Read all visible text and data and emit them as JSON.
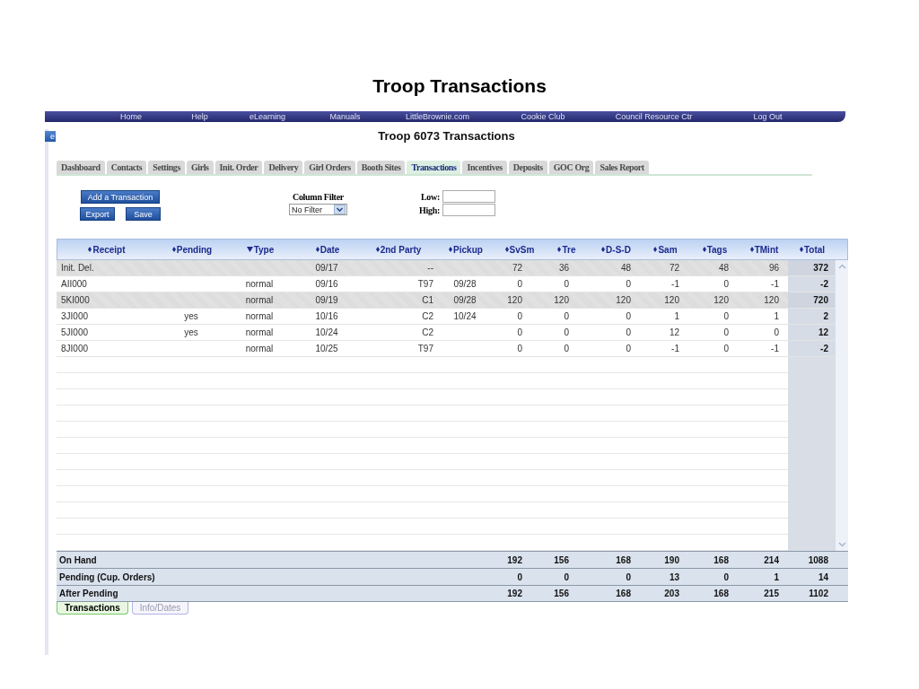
{
  "slide_title": "Troop Transactions",
  "nav_links": [
    "Home",
    "Help",
    "eLearning",
    "Manuals",
    "LittleBrownie.com",
    "Cookie Club",
    "Council Resource Ctr",
    "Log Out"
  ],
  "edge_button": {
    "label": "e"
  },
  "page_title": "Troop 6073 Transactions",
  "tabs": [
    {
      "label": "Dashboard",
      "selected": false
    },
    {
      "label": "Contacts",
      "selected": false
    },
    {
      "label": "Settings",
      "selected": false
    },
    {
      "label": "Girls",
      "selected": false
    },
    {
      "label": "Init. Order",
      "selected": false
    },
    {
      "label": "Delivery",
      "selected": false
    },
    {
      "label": "Girl Orders",
      "selected": false
    },
    {
      "label": "Booth Sites",
      "selected": false
    },
    {
      "label": "Transactions",
      "selected": true
    },
    {
      "label": "Incentives",
      "selected": false
    },
    {
      "label": "Deposits",
      "selected": false
    },
    {
      "label": "GOC Org",
      "selected": false
    },
    {
      "label": "Sales Report",
      "selected": false
    }
  ],
  "buttons": [
    "Add a Transaction",
    "Export",
    "Save"
  ],
  "column_filter": {
    "label": "Column Filter",
    "value": "No Filter"
  },
  "range_fields": [
    {
      "label": "Low:"
    },
    {
      "label": "High:"
    }
  ],
  "table": {
    "columns": [
      {
        "label": "Receipt",
        "sorted": false
      },
      {
        "label": "Pending",
        "sorted": false
      },
      {
        "label": "Type",
        "sorted": true
      },
      {
        "label": "Date",
        "sorted": false
      },
      {
        "label": "2nd Party",
        "sorted": false
      },
      {
        "label": "Pickup",
        "sorted": false
      },
      {
        "label": "SvSm",
        "sorted": false
      },
      {
        "label": "Tre",
        "sorted": false
      },
      {
        "label": "D-S-D",
        "sorted": false
      },
      {
        "label": "Sam",
        "sorted": false
      },
      {
        "label": "Tags",
        "sorted": false
      },
      {
        "label": "TMint",
        "sorted": false
      },
      {
        "label": "Total",
        "sorted": false
      }
    ],
    "rows": [
      {
        "receipt": "Init. Del.",
        "date": "09/17",
        "second_party": "--",
        "counts": [
          "72",
          "36",
          "48",
          "72",
          "48",
          "96"
        ],
        "total": "372",
        "shaded": true
      },
      {
        "receipt": "AII000",
        "type": "normal",
        "date": "09/16",
        "second_party": "T97",
        "pickup": "09/28",
        "counts": [
          "0",
          "0",
          "0",
          "-1",
          "0",
          "-1"
        ],
        "total": "-2",
        "shaded": false
      },
      {
        "receipt": "5KI000",
        "type": "normal",
        "date": "09/19",
        "second_party": "C1",
        "pickup": "09/28",
        "counts": [
          "120",
          "120",
          "120",
          "120",
          "120",
          "120"
        ],
        "total": "720",
        "shaded": true
      },
      {
        "receipt": "3JI000",
        "pending": "yes",
        "type": "normal",
        "date": "10/16",
        "second_party": "C2",
        "pickup": "10/24",
        "counts": [
          "0",
          "0",
          "0",
          "1",
          "0",
          "1"
        ],
        "total": "2",
        "shaded": false
      },
      {
        "receipt": "5JI000",
        "pending": "yes",
        "type": "normal",
        "date": "10/24",
        "second_party": "C2",
        "counts": [
          "0",
          "0",
          "0",
          "12",
          "0",
          "0"
        ],
        "total": "12",
        "shaded": false
      },
      {
        "receipt": "8JI000",
        "type": "normal",
        "date": "10/25",
        "second_party": "T97",
        "counts": [
          "0",
          "0",
          "0",
          "-1",
          "0",
          "-1"
        ],
        "total": "-2",
        "shaded": false
      }
    ],
    "summary": [
      {
        "label": "On Hand",
        "values": [
          "192",
          "156",
          "168",
          "190",
          "168",
          "214",
          "1088"
        ]
      },
      {
        "label": "Pending (Cup. Orders)",
        "values": [
          "0",
          "0",
          "0",
          "13",
          "0",
          "1",
          "14"
        ]
      },
      {
        "label": "After Pending",
        "values": [
          "192",
          "156",
          "168",
          "203",
          "168",
          "215",
          "1102"
        ]
      }
    ]
  },
  "bottom_tabs": [
    {
      "label": "Transactions",
      "selected": true
    },
    {
      "label": "Info/Dates",
      "selected": false
    }
  ]
}
